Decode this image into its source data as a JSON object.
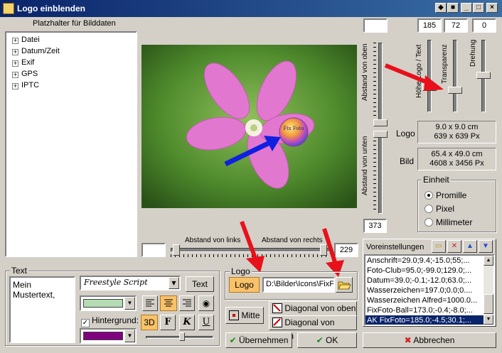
{
  "window": {
    "title": "Logo einblenden",
    "controls": [
      "◆",
      "■",
      "_",
      "□",
      "×"
    ]
  },
  "tree": {
    "heading": "Platzhalter für Bilddaten",
    "items": [
      "Datei",
      "Datum/Zeit",
      "Exif",
      "GPS",
      "IPTC"
    ]
  },
  "image": {
    "logo_text": "Fix Foto"
  },
  "fields": {
    "top_blank": "",
    "hoehe": "185",
    "transparenz": "72",
    "drehung": "0",
    "abstand_unten": "373",
    "abstand_links": "",
    "abstand_rechts": "229"
  },
  "labels": {
    "abstand_oben": "Abstand von oben",
    "abstand_unten": "Abstand von unten",
    "abstand_links": "Abstand von links",
    "abstand_rechts": "Abstand von rechts",
    "hoehe": "Höhe Logo / Text",
    "transparenz": "Transparenz",
    "drehung": "Drehung",
    "logo": "Logo",
    "bild": "Bild"
  },
  "info": {
    "logo_line1": "9.0 x 9.0 cm",
    "logo_line2": "639 x 639 Px",
    "bild_line1": "65.4 x 49.0 cm",
    "bild_line2": "4608 x 3456 Px"
  },
  "einheit": {
    "label": "Einheit",
    "options": [
      "Promille",
      "Pixel",
      "Millimeter"
    ],
    "selected": "Promille"
  },
  "presets": {
    "label": "Voreinstellungen",
    "items": [
      "Anschrift=29.0;9.4;-15.0;55;...",
      "Foto-Club=95.0;-99.0;129.0;...",
      "Datum=39.0;-0.1;-12.0;63.0;...",
      "Wasserzeichen=197.0;0.0;0....",
      "Wasserzeichen Alfred=1000.0...",
      "FixFoto-Ball=173.0;-0.4;-8.0;...",
      "AK FixFoto=185.0;-4.5;30.1;..."
    ],
    "selected_index": 6
  },
  "text_group": {
    "label": "Text",
    "text_value": "Mein Mustertext,",
    "font_name": "Freestyle Script",
    "text_button": "Text",
    "hintergrund": "Hintergrund:",
    "btn_3d": "3D",
    "btn_bold": "F",
    "btn_italic": "K",
    "btn_underline": "U",
    "text_color": "#b5dcb5",
    "bg_color": "#800080"
  },
  "logo_group": {
    "label": "Logo",
    "logo_button": "Logo",
    "path": "D:\\Bilder\\Icons\\FixF"
  },
  "buttons": {
    "mitte": "Mitte",
    "diag_oben": "Diagonal von oben",
    "diag_unten": "Diagonal von unten",
    "uebernehmen": "Übernehmen",
    "ok": "OK",
    "abbrechen": "Abbrechen"
  },
  "colors": {
    "title_start": "#0a246a",
    "title_end": "#3a6ea5",
    "highlight": "#f9c26a",
    "arrow_red": "#e8101a",
    "arrow_blue": "#1020e0",
    "selection": "#0a246a"
  }
}
